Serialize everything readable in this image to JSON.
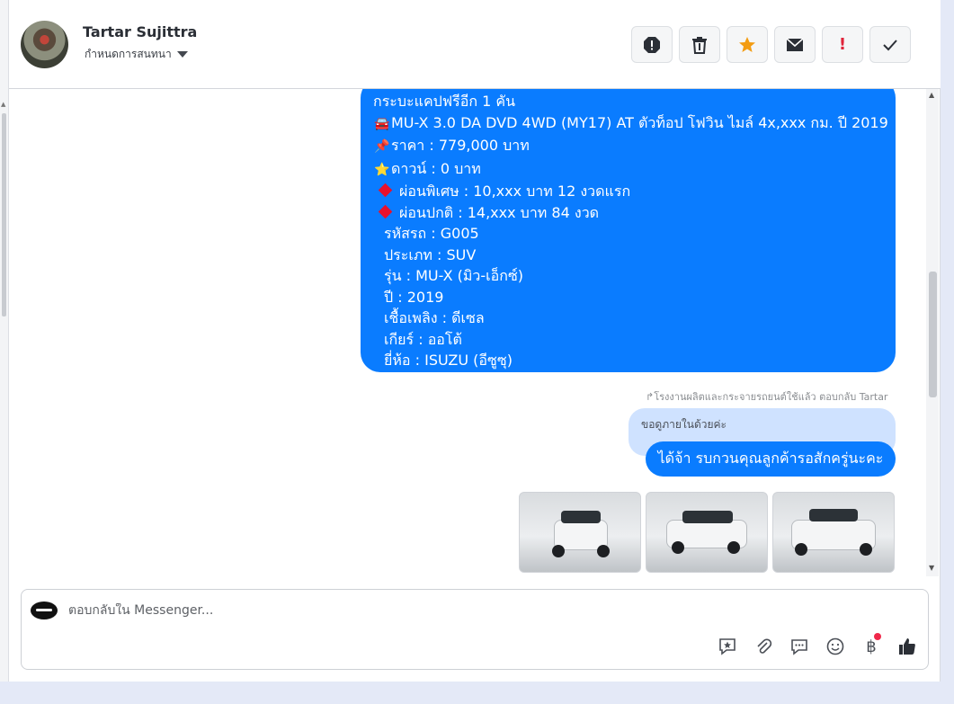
{
  "header": {
    "contact_name": "Tartar Sujittra",
    "assign_label": "กำหนดการสนทนา",
    "toolbar": [
      "spam-icon",
      "trash-icon",
      "star-icon",
      "mail-icon",
      "important-icon",
      "check-icon"
    ]
  },
  "messages": {
    "listing_lines": [
      {
        "prefix": "",
        "text": "กระบะแคปฟรีอีก 1 คัน"
      },
      {
        "prefix": "🚘",
        "text": "MU-X 3.0 DA DVD 4WD (MY17) AT ตัวท็อป โฟวิน ไมล์ 4x,xxx กม. ปี 2019"
      },
      {
        "prefix": "📌",
        "text": "ราคา : 779,000 บาท"
      },
      {
        "prefix": "⭐",
        "text": "ดาวน์ : 0 บาท"
      },
      {
        "prefix": "diamond",
        "text": "ผ่อนพิเศษ : 10,xxx บาท 12 งวดแรก"
      },
      {
        "prefix": "diamond",
        "text": "ผ่อนปกติ : 14,xxx บาท 84 งวด"
      },
      {
        "prefix": "indent",
        "text": "รหัสรถ : G005"
      },
      {
        "prefix": "indent",
        "text": "ประเภท : SUV"
      },
      {
        "prefix": "indent",
        "text": "รุ่น : MU-X (มิว-เอ็กซ์)"
      },
      {
        "prefix": "indent",
        "text": "ปี : 2019"
      },
      {
        "prefix": "indent",
        "text": "เชื้อเพลิง : ดีเซล"
      },
      {
        "prefix": "indent",
        "text": "เกียร์ : ออโต้"
      },
      {
        "prefix": "indent",
        "text": "ยี่ห้อ : ISUZU (อีซูซุ)"
      }
    ],
    "reply_meta": "โรงงานผลิตและกระจายรถยนต์ใช้แล้ว ตอบกลับ Tartar",
    "quoted_text": "ขอดูภายในด้วยค่ะ",
    "reply_text": "ได้จ้า รบกวนคุณลูกค้ารอสักครู่นะคะ",
    "photos": [
      "car-front-photo",
      "car-side-photo",
      "car-rear-photo"
    ]
  },
  "composer": {
    "placeholder": "ตอบกลับใน Messenger...",
    "tools": [
      "saved-reply-icon",
      "attachment-icon",
      "chat-icon",
      "emoji-icon",
      "baht-icon",
      "like-icon"
    ]
  }
}
